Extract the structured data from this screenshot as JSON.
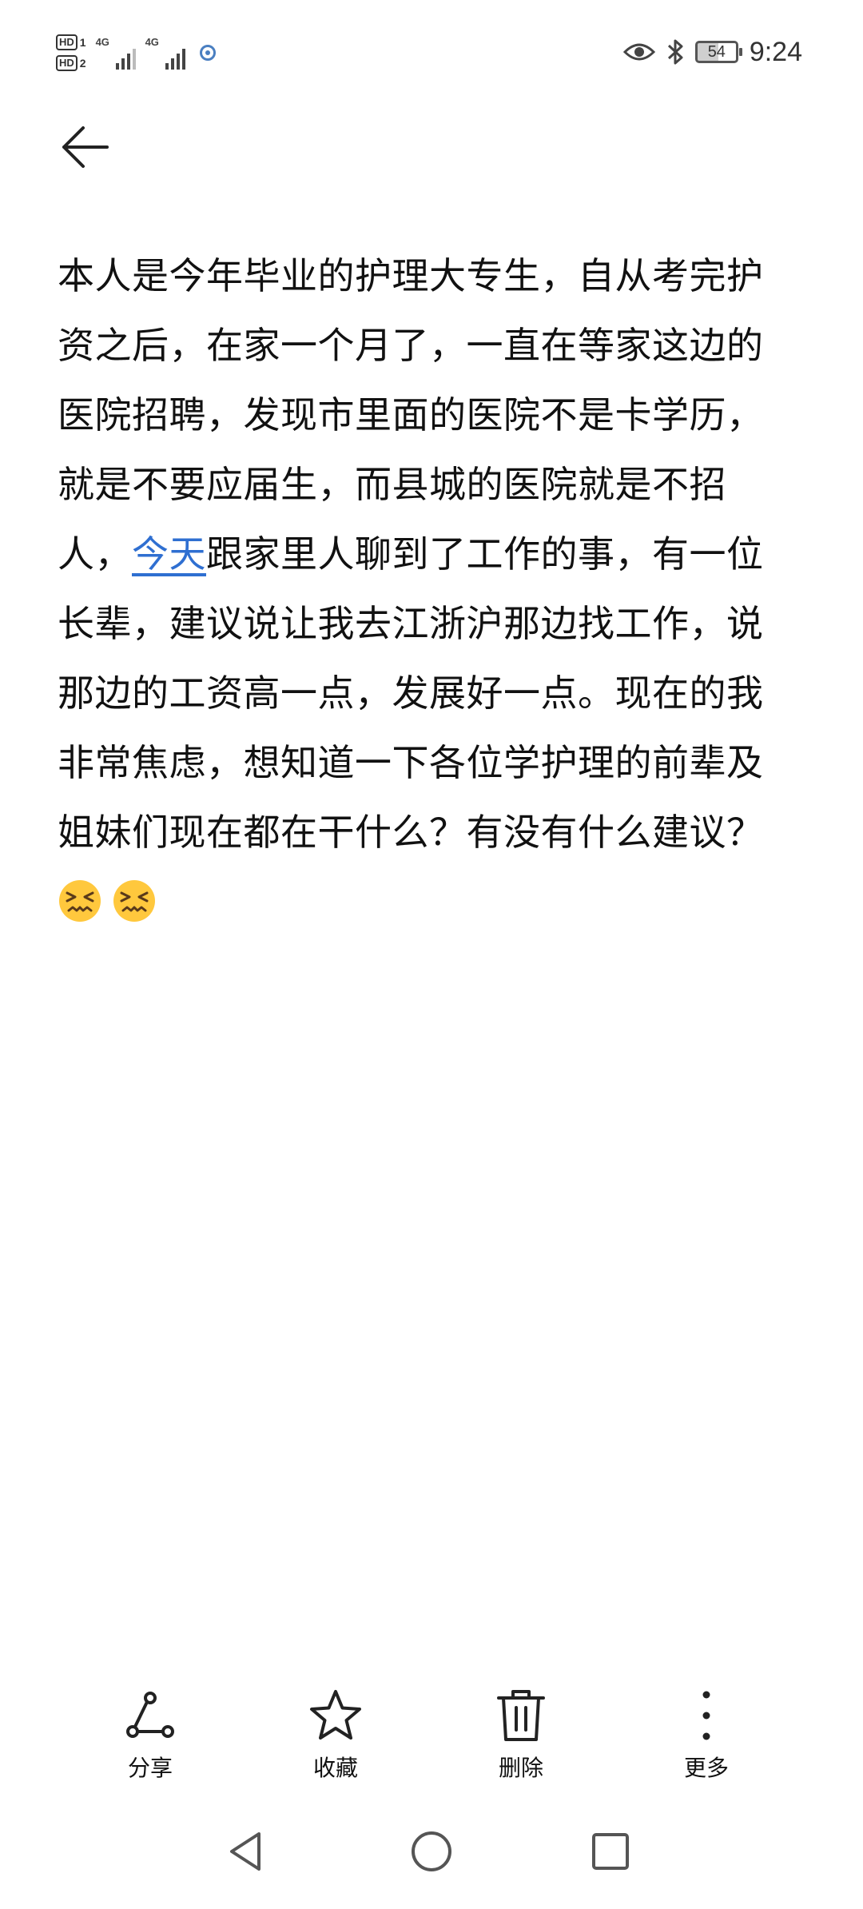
{
  "status_bar": {
    "sim1_label": "HD",
    "sim1_index": "1",
    "sim2_label": "HD",
    "sim2_index": "2",
    "network1": "4G",
    "network2": "4G",
    "battery": "54",
    "time": "9:24",
    "icons": [
      "eye-icon",
      "bluetooth-icon",
      "battery-icon",
      "camera-status-icon"
    ]
  },
  "header": {
    "back_icon": "arrow-left-icon"
  },
  "post": {
    "text_before_link": "本人是今年毕业的护理大专生，自从考完护资之后，在家一个月了，一直在等家这边的医院招聘，发现市里面的医院不是卡学历，就是不要应届生，而县城的医院就是不招人，",
    "link_text": "今天",
    "text_after_link": "跟家里人聊到了工作的事，有一位长辈，建议说让我去江浙沪那边找工作，说那边的工资高一点，发展好一点。现在的我非常焦虑，想知道一下各位学护理的前辈及姐妹们现在都在干什么？有没有什么建议？",
    "emojis": [
      "confounded-face-emoji",
      "confounded-face-emoji"
    ],
    "link_color": "#2f6fd1"
  },
  "actions": [
    {
      "label": "分享",
      "icon": "share-icon"
    },
    {
      "label": "收藏",
      "icon": "star-icon"
    },
    {
      "label": "删除",
      "icon": "trash-icon"
    },
    {
      "label": "更多",
      "icon": "more-vertical-icon"
    }
  ],
  "nav": {
    "icons": [
      "back-triangle-icon",
      "home-circle-icon",
      "recents-square-icon"
    ]
  }
}
